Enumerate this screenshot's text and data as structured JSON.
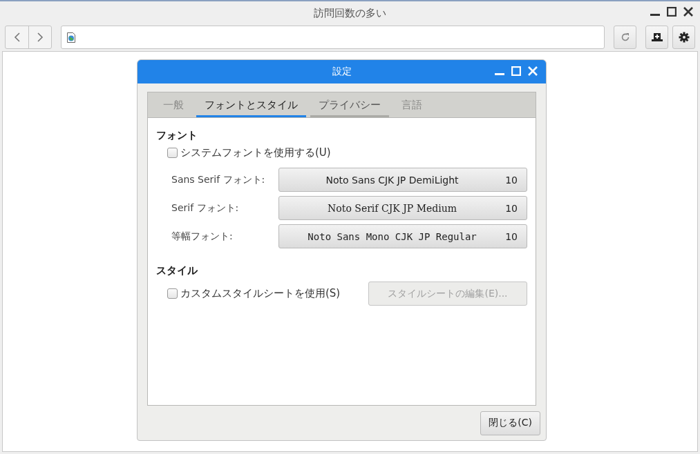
{
  "window": {
    "title": "訪問回数の多い"
  },
  "dialog": {
    "title": "設定",
    "tabs": [
      {
        "label": "一般",
        "selected": false,
        "hovered": false
      },
      {
        "label": "フォントとスタイル",
        "selected": true,
        "hovered": false
      },
      {
        "label": "プライバシー",
        "selected": false,
        "hovered": true
      },
      {
        "label": "言語",
        "selected": false,
        "hovered": false
      }
    ],
    "fonts_section": {
      "heading": "フォント",
      "system_font": {
        "label": "システムフォントを使用する(U)",
        "checked": false
      },
      "rows": [
        {
          "label": "Sans Serif フォント:",
          "font": "Noto Sans CJK JP DemiLight",
          "size": "10",
          "kind": "sans"
        },
        {
          "label": "Serif フォント:",
          "font": "Noto Serif CJK JP Medium",
          "size": "10",
          "kind": "serif"
        },
        {
          "label": "等幅フォント:",
          "font": "Noto Sans Mono CJK JP Regular",
          "size": "10",
          "kind": "mono"
        }
      ]
    },
    "style_section": {
      "heading": "スタイル",
      "custom_stylesheet": {
        "label": "カスタムスタイルシートを使用(S)",
        "checked": false
      },
      "edit_button": {
        "label": "スタイルシートの編集(E)...",
        "disabled": true
      }
    },
    "close_button": "閉じる(C)"
  }
}
